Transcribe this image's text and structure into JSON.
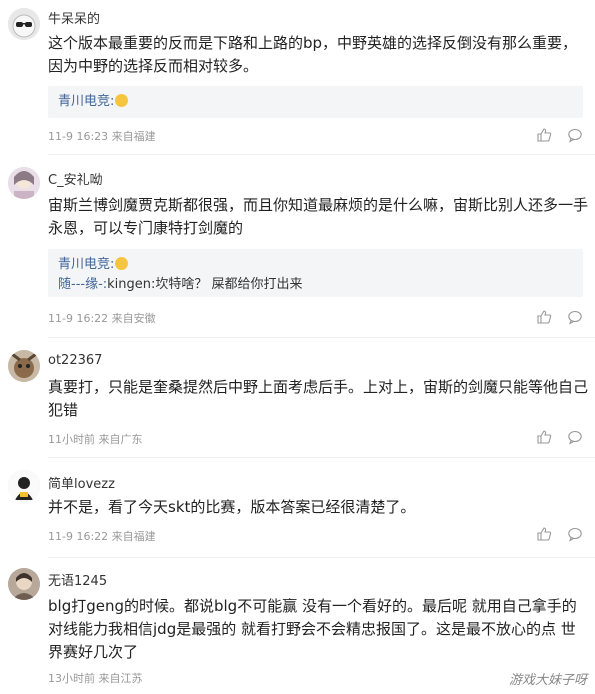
{
  "comments": [
    {
      "username": "牛呆呆的",
      "text": "这个版本最重要的反而是下路和上路的bp，中野英雄的选择反倒没有那么重要，因为中野的选择反而相对较多。",
      "reply_user": "青川电竞:",
      "reply_text": "",
      "meta": "11-9 16:23 来自福建"
    },
    {
      "username": "C_安礼呦",
      "text": "宙斯兰博剑魔贾克斯都很强，而且你知道最麻烦的是什么嘛，宙斯比别人还多一手永恩，可以专门康特打剑魔的",
      "reply_user": "青川电竞:",
      "reply_user2": "随---缘-:",
      "reply_text2": "kingen:坎特啥？ 屎都给你打出来",
      "meta": "11-9 16:22 来自安徽"
    },
    {
      "username": "ot22367",
      "text": "真要打，只能是奎桑提然后中野上面考虑后手。上对上，宙斯的剑魔只能等他自己犯错",
      "meta": "11小时前 来自广东"
    },
    {
      "username": "简单lovezz",
      "text": "并不是，看了今天skt的比赛，版本答案已经很清楚了。",
      "meta": "11-9 16:22 来自福建"
    },
    {
      "username": "无语1245",
      "text": "blg打geng的时候。都说blg不可能赢 没有一个看好的。最后呢 就用自己拿手的 对线能力我相信jdg是最强的 就看打野会不会精忠报国了。这是最不放心的点 世界赛好几次了",
      "meta": "13小时前 来自江苏"
    }
  ],
  "watermark": "游戏大妹子呀",
  "icons": {
    "like": "thumbs-up-icon",
    "reply": "speech-bubble-icon"
  }
}
